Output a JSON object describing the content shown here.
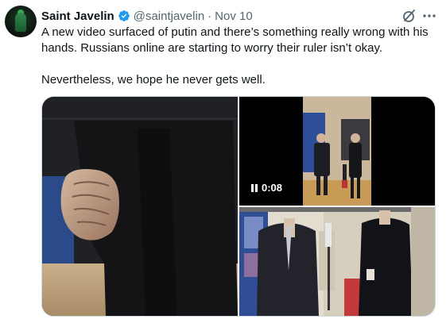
{
  "author": {
    "name": "Saint Javelin",
    "handle": "@saintjavelin",
    "separator": "·",
    "date": "Nov 10"
  },
  "tweet": {
    "paragraph1": "A new video surfaced of putin and there’s something really wrong with his hands. Russians online are starting to worry their ruler isn’t okay.",
    "paragraph2": "Nevertheless, we hope he never gets well."
  },
  "media": {
    "video_duration": "0:08"
  },
  "icons": {
    "verified": "verified-badge-icon",
    "grok": "grok-icon",
    "more": "more-icon",
    "pause": "pause-icon"
  },
  "colors": {
    "verified_blue": "#1d9bf0",
    "secondary_text": "#536471",
    "primary_text": "#0f1419",
    "border": "#cfd9de"
  }
}
